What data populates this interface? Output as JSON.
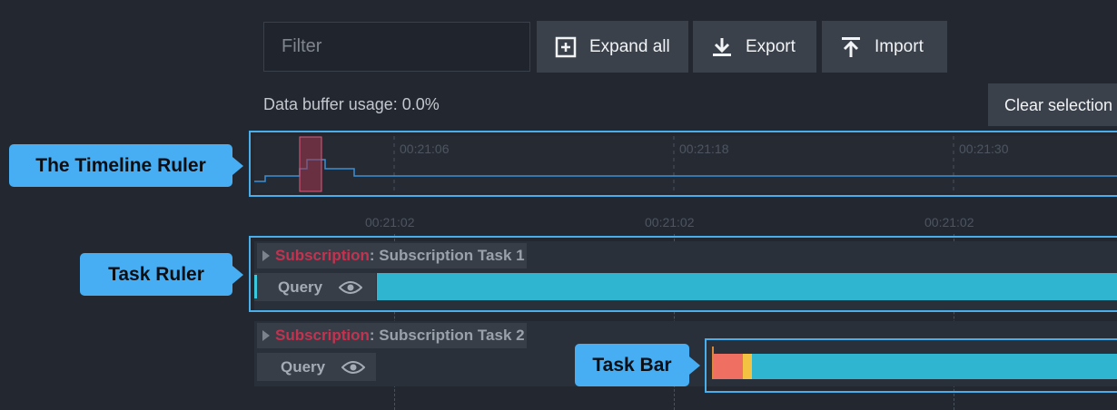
{
  "filter": {
    "placeholder": "Filter",
    "value": ""
  },
  "toolbar": {
    "expand_label": "Expand all",
    "export_label": "Export",
    "import_label": "Import"
  },
  "buffer": {
    "label": "Data buffer usage: 0.0%"
  },
  "clear_selection_label": "Clear selection",
  "timeline": {
    "ticks": [
      "00:21:06",
      "00:21:18",
      "00:21:30"
    ],
    "ruler_ticks": [
      "00:21:02",
      "00:21:02",
      "00:21:02"
    ]
  },
  "tasks": [
    {
      "prefix": "Subscription",
      "name": "Subscription Task 1",
      "query_label": "Query"
    },
    {
      "prefix": "Subscription",
      "name": "Subscription Task 2",
      "query_label": "Query"
    }
  ],
  "callouts": {
    "timeline_ruler": "The Timeline Ruler",
    "task_ruler": "Task Ruler",
    "task_bar": "Task Bar"
  },
  "colors": {
    "accent_highlight": "#4aaeea",
    "task_bar": "#2fb5cf",
    "task_bar_start": "#ef6f62",
    "task_bar_mid": "#f3c242",
    "subscription_prefix": "#c5324f"
  }
}
